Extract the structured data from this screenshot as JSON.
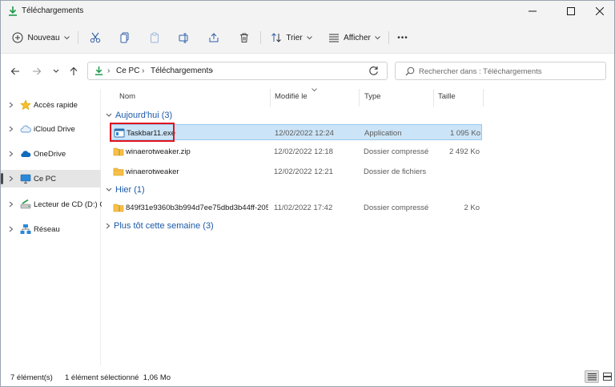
{
  "window": {
    "title": "Téléchargements"
  },
  "toolbar": {
    "new_label": "Nouveau",
    "sort_label": "Trier",
    "view_label": "Afficher",
    "more_label": "•••"
  },
  "address": {
    "crumbs": [
      "Ce PC",
      "Téléchargements"
    ],
    "separator": "›"
  },
  "search": {
    "placeholder": "Rechercher dans : Téléchargements"
  },
  "sidebar": {
    "items": [
      {
        "label": "Accès rapide",
        "icon": "star-icon"
      },
      {
        "label": "iCloud Drive",
        "icon": "cloud-icon"
      },
      {
        "label": "OneDrive",
        "icon": "cloud-icon"
      },
      {
        "label": "Ce PC",
        "icon": "monitor-icon",
        "selected": true
      },
      {
        "label": "Lecteur de CD (D:) C",
        "icon": "cd-drive-icon"
      },
      {
        "label": "Réseau",
        "icon": "network-icon"
      }
    ]
  },
  "columns": {
    "name": "Nom",
    "modified": "Modifié le",
    "type": "Type",
    "size": "Taille"
  },
  "groups": [
    {
      "label": "Aujourd'hui (3)",
      "expanded": true,
      "files": [
        {
          "name": "Taskbar11.exe",
          "modified": "12/02/2022 12:24",
          "type": "Application",
          "size": "1 095 Ko",
          "icon": "application-icon",
          "selected": true
        },
        {
          "name": "winaerotweaker.zip",
          "modified": "12/02/2022 12:18",
          "type": "Dossier compressé",
          "size": "2 492 Ko",
          "icon": "zip-folder-icon"
        },
        {
          "name": "winaerotweaker",
          "modified": "12/02/2022 12:21",
          "type": "Dossier de fichiers",
          "size": "",
          "icon": "folder-icon"
        }
      ]
    },
    {
      "label": "Hier (1)",
      "expanded": true,
      "files": [
        {
          "name": "849f31e9360b3b994d7ee75dbd3b44ff-205...",
          "modified": "11/02/2022 17:42",
          "type": "Dossier compressé",
          "size": "2 Ko",
          "icon": "zip-folder-icon"
        }
      ]
    },
    {
      "label": "Plus tôt cette semaine (3)",
      "expanded": false,
      "files": []
    }
  ],
  "status": {
    "item_count": "7 élément(s)",
    "selection": "1 élément sélectionné  1,06 Mo"
  },
  "colors": {
    "accent": "#1e5aa8",
    "selection_bg": "#cce4f7",
    "highlight_box": "#e0141e"
  }
}
